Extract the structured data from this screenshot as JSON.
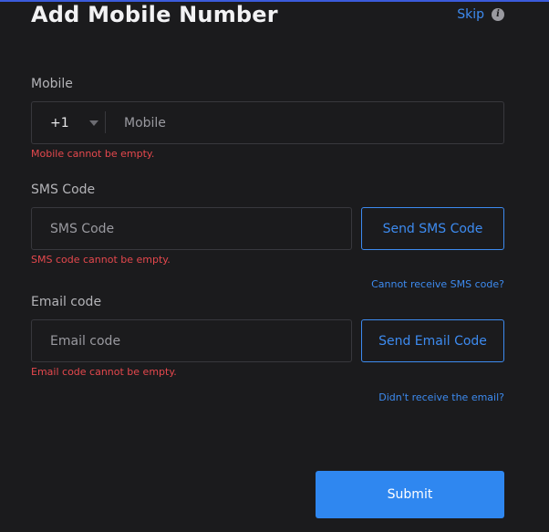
{
  "header": {
    "title": "Add Mobile Number",
    "skip_label": "Skip",
    "info_icon": "i"
  },
  "mobile": {
    "label": "Mobile",
    "country_code": "+1",
    "placeholder": "Mobile",
    "value": "",
    "error": "Mobile cannot be empty."
  },
  "sms": {
    "label": "SMS Code",
    "placeholder": "SMS Code",
    "value": "",
    "send_button": "Send SMS Code",
    "error": "SMS code cannot be empty.",
    "help_link": "Cannot receive SMS code?"
  },
  "email": {
    "label": "Email code",
    "placeholder": "Email code",
    "value": "",
    "send_button": "Send Email Code",
    "error": "Email code cannot be empty.",
    "help_link": "Didn't receive the email?"
  },
  "submit_label": "Submit",
  "colors": {
    "background": "#1b1b1d",
    "accent": "#3d8bf0",
    "primary_button": "#2f87f0",
    "error": "#e5484d",
    "field_border": "#38383d"
  }
}
